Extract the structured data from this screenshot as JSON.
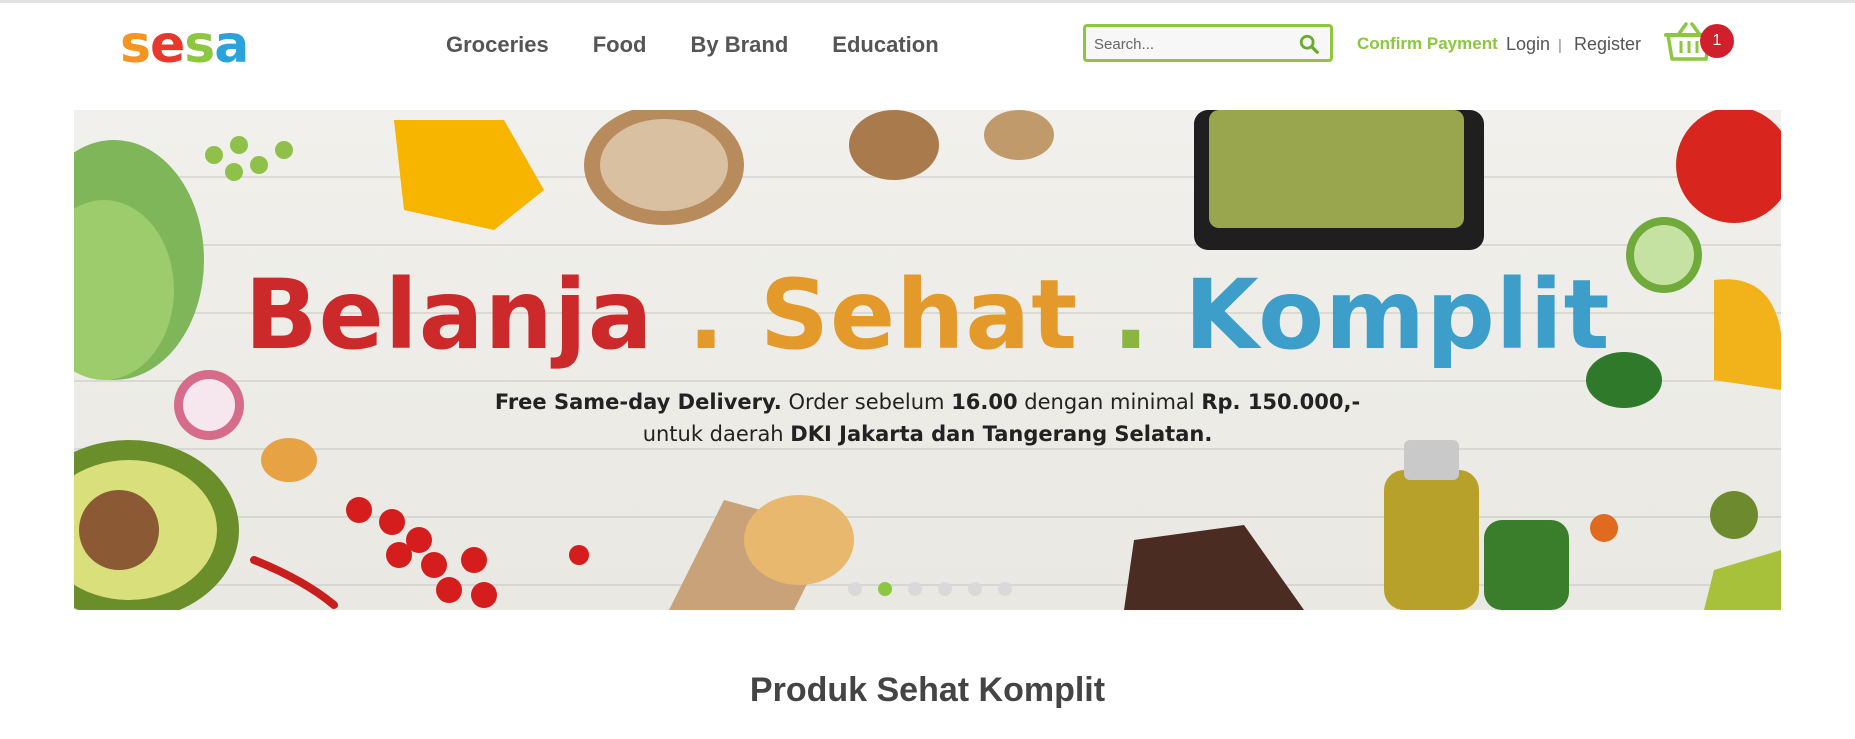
{
  "logo": {
    "text": "sesa",
    "letters": [
      "s",
      "e",
      "s",
      "a"
    ],
    "colors": [
      "#f7941d",
      "#e8372d",
      "#8dc63f",
      "#2aa3dd"
    ]
  },
  "nav": [
    {
      "label": "Groceries"
    },
    {
      "label": "Food"
    },
    {
      "label": "By Brand"
    },
    {
      "label": "Education"
    }
  ],
  "search": {
    "placeholder": "Search...",
    "icon": "search-icon"
  },
  "account": {
    "confirm_payment": "Confirm Payment",
    "login": "Login",
    "separator": "|",
    "register": "Register"
  },
  "cart": {
    "icon": "basket-icon",
    "count": "1"
  },
  "banner": {
    "title_parts": [
      "Belanja",
      " . ",
      "Sehat",
      " . ",
      "Komplit"
    ],
    "line1_a": "Free Same-day Delivery.",
    "line1_b": " Order sebelum ",
    "line1_c": "16.00",
    "line1_d": " dengan minimal ",
    "line1_e": "Rp. 150.000,-",
    "line2_a": "untuk daerah ",
    "line2_b": "DKI Jakarta dan Tangerang Selatan.",
    "slides": 6,
    "active_slide": 2
  },
  "section": {
    "title": "Produk Sehat Komplit"
  },
  "colors": {
    "accent": "#8dc63f",
    "badge": "#d0202b"
  }
}
